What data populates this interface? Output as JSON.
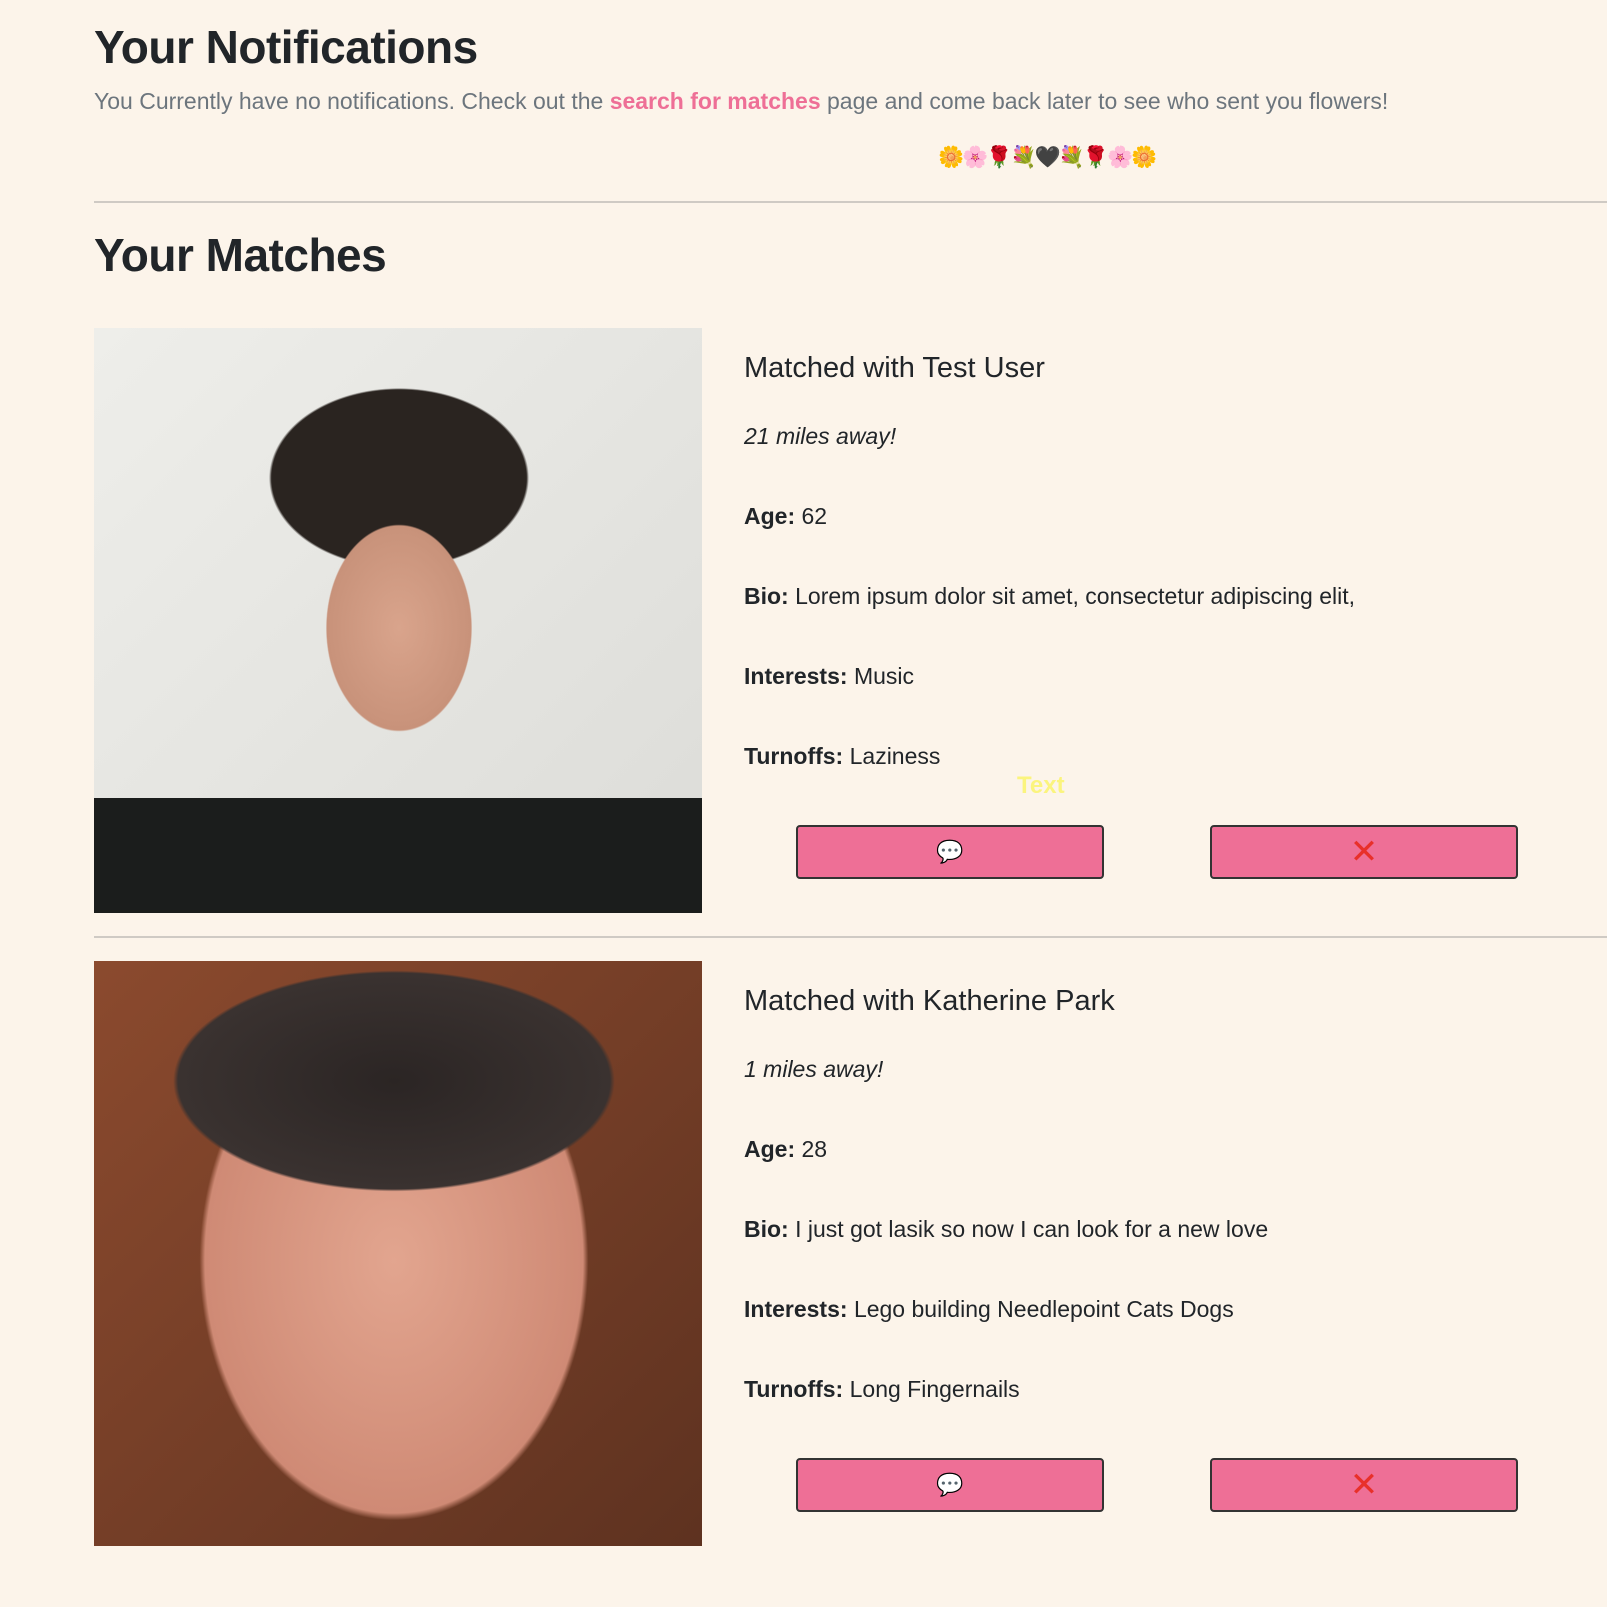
{
  "notifications": {
    "title": "Your Notifications",
    "text_before": "You Currently have no notifications. Check out the ",
    "link": "search for matches",
    "text_after": " page and come back later to see who sent you flowers!",
    "emojis": "🌼🌸🌹💐🖤💐🌹🌸🌼"
  },
  "matches": {
    "title": "Your Matches",
    "labels": {
      "age": "Age:",
      "bio": "Bio:",
      "interests": "Interests:",
      "turnoffs": "Turnoffs:"
    },
    "message_icon": "💬",
    "remove_icon": "✕",
    "items": [
      {
        "name": "Matched with Test User",
        "distance": "21 miles away!",
        "age": "62",
        "bio": "Lorem ipsum dolor sit amet, consectetur adipiscing elit,",
        "interests": "Music",
        "turnoffs": "Laziness",
        "hint": "Text"
      },
      {
        "name": "Matched with Katherine Park",
        "distance": "1 miles away!",
        "age": "28",
        "bio": "I just got lasik so now I can look for a new love",
        "interests": "Lego building Needlepoint Cats Dogs",
        "turnoffs": "Long Fingernails"
      }
    ]
  }
}
